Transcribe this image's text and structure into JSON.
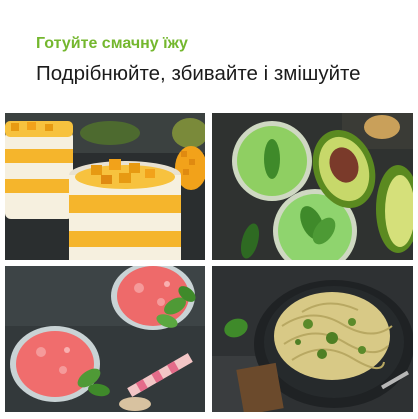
{
  "header": {
    "subtitle": "Готуйте смачну їжу",
    "title": "Подрібнюйте, збивайте і змішуйте"
  },
  "tiles": [
    {
      "name": "mango-yogurt-parfait-photo"
    },
    {
      "name": "green-smoothie-avocado-photo"
    },
    {
      "name": "watermelon-granita-photo"
    },
    {
      "name": "pesto-pasta-photo"
    }
  ],
  "colors": {
    "accent": "#74b72e",
    "text": "#1b1b1b"
  }
}
